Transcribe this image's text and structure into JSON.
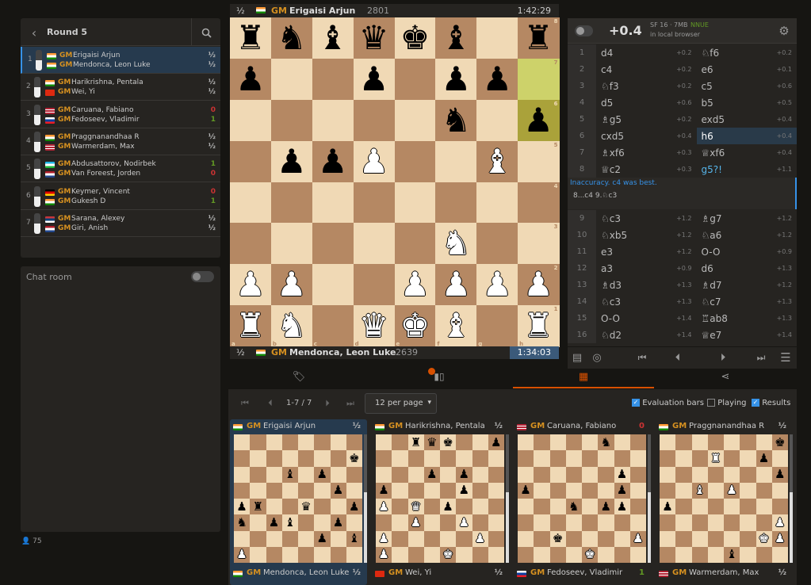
{
  "round": {
    "title": "Round 5"
  },
  "games": [
    {
      "num": "1",
      "w_flag": "in",
      "w_name": "Erigaisi Arjun",
      "w_res": "½",
      "b_flag": "in",
      "b_name": "Mendonca, Leon Luke",
      "b_res": "½",
      "w_res_color": "#bababa",
      "b_res_color": "#bababa"
    },
    {
      "num": "2",
      "w_flag": "in",
      "w_name": "Harikrishna, Pentala",
      "w_res": "½",
      "b_flag": "cn",
      "b_name": "Wei, Yi",
      "b_res": "½",
      "w_res_color": "#bababa",
      "b_res_color": "#bababa"
    },
    {
      "num": "3",
      "w_flag": "us",
      "w_name": "Caruana, Fabiano",
      "w_res": "0",
      "b_flag": "si",
      "b_name": "Fedoseev, Vladimir",
      "b_res": "1",
      "w_res_color": "#cc3333",
      "b_res_color": "#629924"
    },
    {
      "num": "4",
      "w_flag": "in",
      "w_name": "Praggnanandhaa R",
      "w_res": "½",
      "b_flag": "us",
      "b_name": "Warmerdam, Max",
      "b_res": "½",
      "w_res_color": "#bababa",
      "b_res_color": "#bababa"
    },
    {
      "num": "5",
      "w_flag": "uz",
      "w_name": "Abdusattorov, Nodirbek",
      "w_res": "1",
      "b_flag": "nl",
      "b_name": "Van Foreest, Jorden",
      "b_res": "0",
      "w_res_color": "#629924",
      "b_res_color": "#cc3333"
    },
    {
      "num": "6",
      "w_flag": "de",
      "w_name": "Keymer, Vincent",
      "w_res": "0",
      "b_flag": "in",
      "b_name": "Gukesh D",
      "b_res": "1",
      "w_res_color": "#cc3333",
      "b_res_color": "#629924"
    },
    {
      "num": "7",
      "w_flag": "rs",
      "w_name": "Sarana, Alexey",
      "w_res": "½",
      "b_flag": "nl",
      "b_name": "Giri, Anish",
      "b_res": "½",
      "w_res_color": "#bababa",
      "b_res_color": "#bababa"
    }
  ],
  "gm_title": "GM",
  "chat": {
    "label": "Chat room",
    "viewers": "75"
  },
  "board": {
    "top_score": "½",
    "top_title": "GM",
    "top_name": "Erigaisi Arjun",
    "top_rating": "2801",
    "top_clock": "1:42:29",
    "bottom_score": "½",
    "bottom_title": "GM",
    "bottom_name": "Mendonca, Leon Luke",
    "bottom_rating": "2639",
    "bottom_clock": "1:34:03",
    "ranks": [
      "8",
      "7",
      "6",
      "5",
      "4",
      "3",
      "2",
      "1"
    ],
    "files": [
      "a",
      "b",
      "c",
      "d",
      "e",
      "f",
      "g",
      "h"
    ],
    "position": [
      [
        "r",
        "n",
        "b",
        "q",
        "k",
        "b",
        "",
        "r"
      ],
      [
        "p",
        "",
        "",
        "p",
        "",
        "p",
        "p",
        ""
      ],
      [
        "",
        "",
        "",
        "",
        "",
        "n",
        "",
        "p"
      ],
      [
        "",
        "p",
        "p",
        "P",
        "",
        "",
        "B",
        ""
      ],
      [
        "",
        "",
        "",
        "",
        "",
        "",
        "",
        ""
      ],
      [
        "",
        "",
        "",
        "",
        "",
        "N",
        "",
        ""
      ],
      [
        "P",
        "P",
        "",
        "",
        "P",
        "P",
        "P",
        "P"
      ],
      [
        "R",
        "N",
        "",
        "Q",
        "K",
        "B",
        "",
        "R"
      ]
    ],
    "highlights": [
      "h7",
      "h6"
    ]
  },
  "engine": {
    "eval": "+0.4",
    "name": "SF 16 · 7MB",
    "nnue": "NNUE",
    "location": "in local browser"
  },
  "moves": [
    {
      "n": "1",
      "w": "d4",
      "we": "+0.2",
      "b": "♘f6",
      "be": "+0.2"
    },
    {
      "n": "2",
      "w": "c4",
      "we": "+0.2",
      "b": "e6",
      "be": "+0.1"
    },
    {
      "n": "3",
      "w": "♘f3",
      "we": "+0.2",
      "b": "c5",
      "be": "+0.6"
    },
    {
      "n": "4",
      "w": "d5",
      "we": "+0.6",
      "b": "b5",
      "be": "+0.5"
    },
    {
      "n": "5",
      "w": "♗g5",
      "we": "+0.2",
      "b": "exd5",
      "be": "+0.4"
    },
    {
      "n": "6",
      "w": "cxd5",
      "we": "+0.4",
      "b": "h6",
      "be": "+0.4"
    },
    {
      "n": "7",
      "w": "♗xf6",
      "we": "+0.3",
      "b": "♕xf6",
      "be": "+0.4"
    },
    {
      "n": "8",
      "w": "♕c2",
      "we": "+0.3",
      "b": "g5?!",
      "be": "+1.1"
    }
  ],
  "comment": {
    "text": "Inaccuracy. c4 was best.",
    "line": "8...c4 9.♘c3"
  },
  "moves2": [
    {
      "n": "9",
      "w": "♘c3",
      "we": "+1.2",
      "b": "♗g7",
      "be": "+1.2"
    },
    {
      "n": "10",
      "w": "♘xb5",
      "we": "+1.2",
      "b": "♘a6",
      "be": "+1.2"
    },
    {
      "n": "11",
      "w": "e3",
      "we": "+1.2",
      "b": "O-O",
      "be": "+0.9"
    },
    {
      "n": "12",
      "w": "a3",
      "we": "+0.9",
      "b": "d6",
      "be": "+1.3"
    },
    {
      "n": "13",
      "w": "♗d3",
      "we": "+1.3",
      "b": "♗d7",
      "be": "+1.2"
    },
    {
      "n": "14",
      "w": "♘c3",
      "we": "+1.3",
      "b": "♘c7",
      "be": "+1.3"
    },
    {
      "n": "15",
      "w": "O-O",
      "we": "+1.4",
      "b": "♖ab8",
      "be": "+1.3"
    },
    {
      "n": "16",
      "w": "♘d2",
      "we": "+1.4",
      "b": "♕e7",
      "be": "+1.4"
    }
  ],
  "pager": {
    "range": "1-7 / 7",
    "per_page": "12 per page",
    "opt_eval": "Evaluation bars",
    "opt_playing": "Playing",
    "opt_results": "Results"
  },
  "minis": [
    {
      "top_flag": "in",
      "top_name": "Erigaisi Arjun",
      "top_res": "½",
      "bot_flag": "in",
      "bot_name": "Mendonca, Leon Luke",
      "bot_res": "½",
      "top_color": "#bababa",
      "bot_color": "#bababa",
      "pos": [
        "",
        "",
        "",
        "",
        "",
        "",
        "",
        "k",
        "",
        "",
        "",
        "b",
        "",
        "p",
        "",
        "",
        "",
        "",
        "",
        "",
        "",
        "",
        "",
        "p",
        "p",
        "r",
        "",
        "p",
        "",
        "q",
        "",
        "p",
        "n",
        "",
        "p",
        "b",
        "",
        "",
        "p",
        "",
        "",
        "",
        "",
        "",
        "p",
        "b",
        "P",
        "",
        "",
        "",
        "",
        "",
        "",
        "",
        "",
        "",
        "P",
        "",
        "",
        "",
        "P",
        "",
        "",
        "",
        "",
        "",
        "",
        "P",
        "",
        "",
        "",
        "",
        "",
        "",
        "",
        "P",
        "P",
        "",
        "",
        "",
        "N",
        "",
        "",
        "",
        "",
        "",
        "",
        "",
        "",
        "",
        "B",
        "",
        "",
        "P",
        "P",
        "",
        "",
        "",
        "Q",
        "",
        "",
        "",
        "P",
        "K",
        "",
        "",
        "R",
        "",
        "",
        "",
        "",
        ""
      ]
    },
    {
      "top_flag": "in",
      "top_name": "Harikrishna, Pentala",
      "top_res": "½",
      "bot_flag": "cn",
      "bot_name": "Wei, Yi",
      "bot_res": "½",
      "top_color": "#bababa",
      "bot_color": "#bababa",
      "pos": []
    },
    {
      "top_flag": "us",
      "top_name": "Caruana, Fabiano",
      "top_res": "0",
      "bot_flag": "si",
      "bot_name": "Fedoseev, Vladimir",
      "bot_res": "1",
      "top_color": "#cc3333",
      "bot_color": "#629924",
      "pos": []
    },
    {
      "top_flag": "in",
      "top_name": "Praggnanandhaa R",
      "top_res": "½",
      "bot_flag": "us",
      "bot_name": "Warmerdam, Max",
      "bot_res": "½",
      "top_color": "#bababa",
      "bot_color": "#bababa",
      "pos": []
    }
  ],
  "colors": {
    "light": "#f0d9b5",
    "dark": "#b58863",
    "highlight_light": "#cdd26a",
    "highlight_dark": "#aaa23a",
    "accent": "#3692e7",
    "orange": "#d59020"
  }
}
